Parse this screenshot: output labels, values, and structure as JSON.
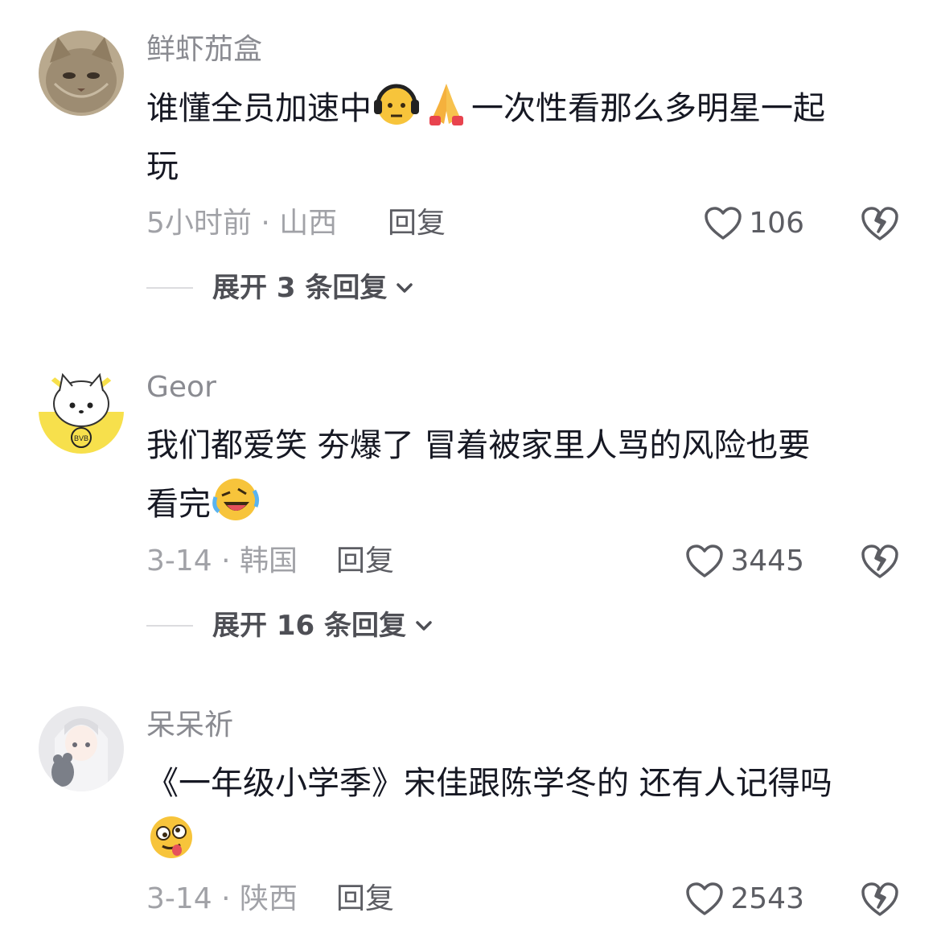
{
  "comments": [
    {
      "username": "鲜虾茄盒",
      "text_a": "谁懂全员加速中",
      "text_b": "一次性看那么多明星一起",
      "text_c": "玩",
      "time": "5小时前 · 山西",
      "reply": "回复",
      "likes": "106",
      "expand": "展开 3 条回复",
      "emoji_a": "face-with-headphones-emoji",
      "emoji_b": "folded-hands-emoji"
    },
    {
      "username": "Geor",
      "text_a": "我们都爱笑 夯爆了 冒着被家里人骂的风险也要",
      "text_b": "看完",
      "time": "3-14 · 韩国",
      "reply": "回复",
      "likes": "3445",
      "expand": "展开 16 条回复",
      "emoji_a": "rolling-laughing-emoji"
    },
    {
      "username": "呆呆祈",
      "text_a": "《一年级小学季》宋佳跟陈学冬的 还有人记得吗",
      "time": "3-14 · 陕西",
      "reply": "回复",
      "likes": "2543",
      "emoji_a": "goofy-face-emoji"
    }
  ],
  "icons": {
    "like": "heart-outline-icon",
    "dislike": "broken-heart-icon",
    "expand": "chevron-down-icon"
  },
  "colors": {
    "text": "#161823",
    "secondary": "#8a8b91",
    "action": "#5c5d63"
  }
}
